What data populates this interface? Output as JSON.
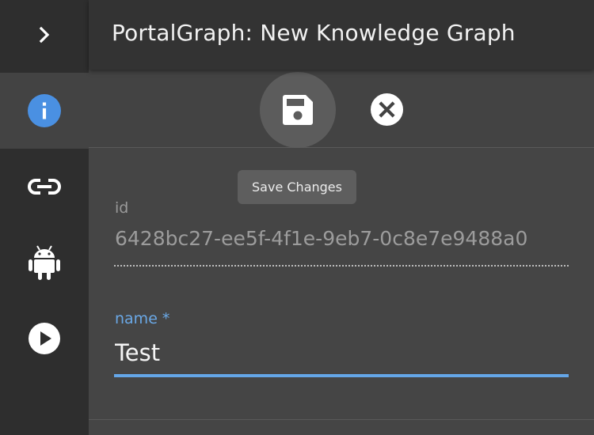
{
  "header": {
    "title": "PortalGraph: New Knowledge Graph"
  },
  "rail": {
    "expand_icon": "chevron-right-icon",
    "items": [
      {
        "name": "info",
        "icon": "info-circle-icon",
        "active": true
      },
      {
        "name": "link",
        "icon": "link-icon",
        "active": false
      },
      {
        "name": "android",
        "icon": "android-icon",
        "active": false
      },
      {
        "name": "play",
        "icon": "play-circle-icon",
        "active": false
      }
    ]
  },
  "toolbar": {
    "save_icon": "floppy-disk-icon",
    "close_icon": "close-circle-icon",
    "save_tooltip": "Save Changes"
  },
  "form": {
    "id_label": "id",
    "id_value": "6428bc27-ee5f-4f1e-9eb7-0c8e7e9488a0",
    "name_label": "name *",
    "name_value": "Test"
  },
  "colors": {
    "accent": "#64a6e8",
    "info_icon": "#4a90e2",
    "rail_bg": "#2e2e2e",
    "content_bg": "#454545"
  }
}
